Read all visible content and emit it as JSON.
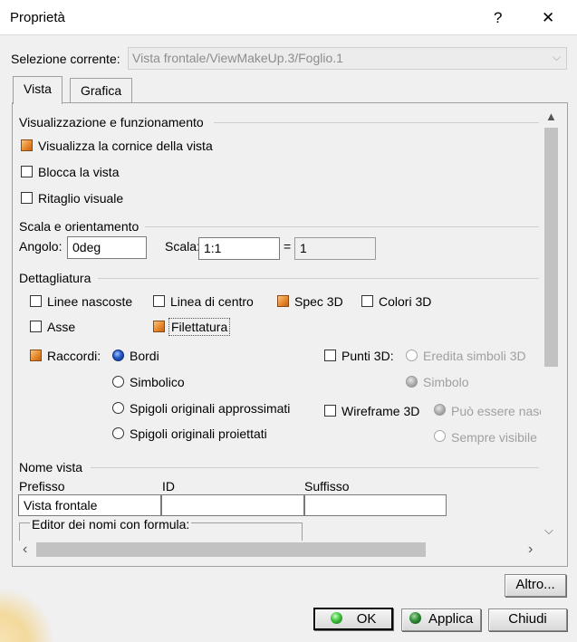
{
  "window": {
    "title": "Proprietà",
    "help_label": "?",
    "close_label": "✕"
  },
  "selection": {
    "label": "Selezione corrente:",
    "value": "Vista frontale/ViewMakeUp.3/Foglio.1",
    "arrow": "⌵"
  },
  "tabs": [
    {
      "label": "Vista"
    },
    {
      "label": "Grafica"
    }
  ],
  "display": {
    "title": "Visualizzazione e funzionamento",
    "show_frame": {
      "label": "Visualizza la cornice della vista",
      "checked": true
    },
    "lock_view": {
      "label": "Blocca la vista",
      "checked": false
    },
    "visual_clip": {
      "label": "Ritaglio visuale",
      "checked": false
    }
  },
  "scale": {
    "title": "Scala e orientamento",
    "angle_label": "Angolo:",
    "angle_value": "0deg",
    "scale_label": "Scala:",
    "scale_value": "1:1",
    "equals": "=",
    "result_value": "1"
  },
  "detail": {
    "title": "Dettagliatura",
    "hidden_lines": {
      "label": "Linee nascoste",
      "checked": false
    },
    "center_line": {
      "label": "Linea di centro",
      "checked": false
    },
    "spec3d": {
      "label": "Spec 3D",
      "checked": true
    },
    "colors3d": {
      "label": "Colori 3D",
      "checked": false
    },
    "axis": {
      "label": "Asse",
      "checked": false
    },
    "threads": {
      "label": "Filettatura",
      "checked": true
    },
    "fillets": {
      "label": "Raccordi:",
      "checked": true
    },
    "fillet_modes": [
      {
        "label": "Bordi",
        "selected": true
      },
      {
        "label": "Simbolico",
        "selected": false
      },
      {
        "label": "Spigoli originali approssimati",
        "selected": false
      },
      {
        "label": "Spigoli originali proiettati",
        "selected": false
      }
    ],
    "points3d": {
      "label": "Punti 3D:",
      "checked": false
    },
    "points_modes": [
      {
        "label": "Eredita simboli 3D",
        "selected": false
      },
      {
        "label": "Simbolo",
        "selected": true
      }
    ],
    "wireframe3d": {
      "label": "Wireframe 3D",
      "checked": false
    },
    "wireframe_modes": [
      {
        "label": "Può essere nasc",
        "selected": true
      },
      {
        "label": "Sempre visibile",
        "selected": false
      }
    ]
  },
  "view_name": {
    "title": "Nome vista",
    "prefix_label": "Prefisso",
    "prefix_value": "Vista frontale",
    "id_label": "ID",
    "id_value": "",
    "suffix_label": "Suffisso",
    "suffix_value": "",
    "editor_label": "Editor dei nomi con formula:"
  },
  "scroll": {
    "up": "▲",
    "down": "⌵",
    "left": "‹",
    "right": "›"
  },
  "buttons": {
    "more": "Altro...",
    "ok": "OK",
    "apply": "Applica",
    "close": "Chiudi"
  },
  "colors": {
    "accent_orange": "#e88a2c",
    "radio_blue": "#2a5bc7",
    "ok_green": "#3ec23a"
  }
}
